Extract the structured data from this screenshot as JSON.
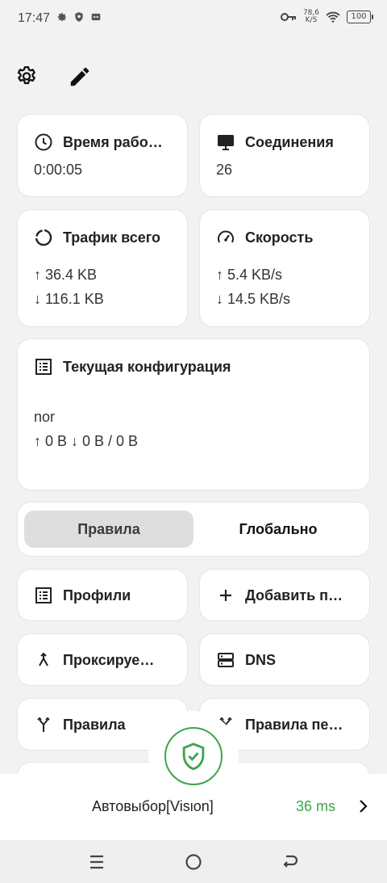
{
  "status_bar": {
    "time": "17:47",
    "speed_value": "78,6",
    "speed_unit": "K/S",
    "battery": "100"
  },
  "toolbar": {
    "settings_icon": "gear-icon",
    "edit_icon": "pencil-icon"
  },
  "stats": {
    "uptime": {
      "title": "Время рабо…",
      "value": "0:00:05"
    },
    "connections": {
      "title": "Соединения",
      "value": "26"
    },
    "traffic": {
      "title": "Трафик всего",
      "up": "↑ 36.4 KB",
      "down": "↓ 116.1 KB"
    },
    "speed": {
      "title": "Скорость",
      "up": "↑ 5.4 KB/s",
      "down": "↓ 14.5 KB/s"
    }
  },
  "config": {
    "title": "Текущая конфигурация",
    "name": "nor",
    "traffic": "↑ 0 B ↓ 0 B / 0 B"
  },
  "mode": {
    "rules": "Правила",
    "global": "Глобально",
    "selected": "rules"
  },
  "tiles": {
    "profiles": "Профили",
    "add": "Добавить п…",
    "proxies": "Проксируе…",
    "dns": "DNS",
    "rules": "Правила",
    "rule_sets": "Правила пе…"
  },
  "proxy": {
    "name": "Автовыбор[Vision]",
    "latency": "36 ms"
  },
  "colors": {
    "accent_green": "#3da44d",
    "background": "#f2f2f2",
    "card": "#ffffff"
  }
}
